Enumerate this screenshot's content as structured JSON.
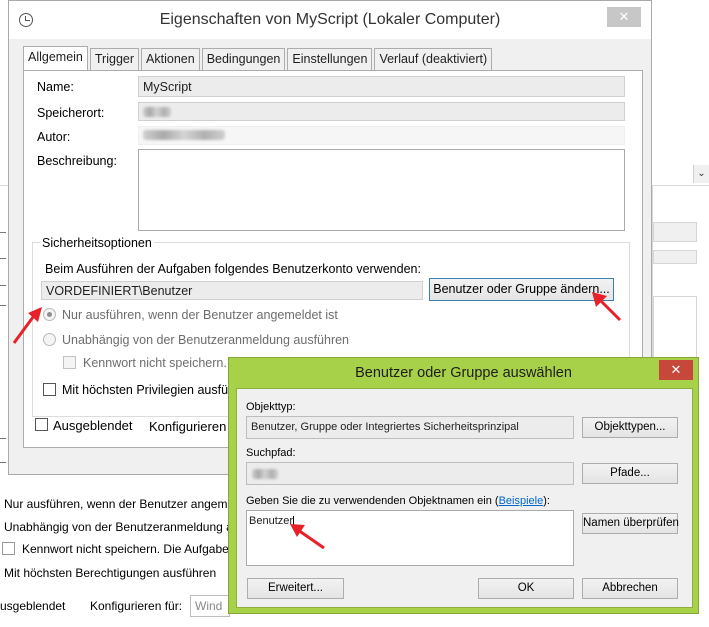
{
  "main_window": {
    "title": "Eigenschaften von MyScript (Lokaler Computer)",
    "close_glyph": "✕",
    "tabs": [
      "Allgemein",
      "Trigger",
      "Aktionen",
      "Bedingungen",
      "Einstellungen",
      "Verlauf (deaktiviert)"
    ],
    "active_tab": "Allgemein",
    "general": {
      "name_label": "Name:",
      "name_value": "MyScript",
      "location_label": "Speicherort:",
      "author_label": "Autor:",
      "description_label": "Beschreibung:"
    },
    "security": {
      "group_title": "Sicherheitsoptionen",
      "account_prompt": "Beim Ausführen der Aufgaben folgendes Benutzerkonto verwenden:",
      "account_value": "VORDEFINIERT\\Benutzer",
      "change_user_button": "Benutzer oder Gruppe ändern...",
      "radio_logged_on": "Nur ausführen, wenn der Benutzer angemeldet ist",
      "radio_independent": "Unabhängig von der Benutzeranmeldung ausführen",
      "no_store_password": "Kennwort nicht speichern.",
      "highest_privileges": "Mit höchsten Privilegien ausfü"
    },
    "hidden_label": "Ausgeblendet",
    "configure_label": "Konfigurieren f"
  },
  "background_window": {
    "scroll_glyph": "⌄",
    "lines": [
      "Nur ausführen, wenn der Benutzer angeme",
      "Unabhängig von der Benutzeranmeldung a",
      "Kennwort nicht speichern. Die Aufgabe",
      "Mit höchsten Berechtigungen ausführen",
      "usgeblendet",
      "Konfigurieren für:",
      "Wind"
    ]
  },
  "dialog": {
    "title": "Benutzer oder Gruppe auswählen",
    "close_glyph": "✕",
    "object_type_label": "Objekttyp:",
    "object_type_value": "Benutzer, Gruppe oder Integriertes Sicherheitsprinzipal",
    "object_types_button": "Objekttypen...",
    "path_label": "Suchpfad:",
    "paths_button": "Pfade...",
    "names_prompt": "Geben Sie die zu verwendenden Objektnamen ein (",
    "names_prompt_link": "Beispiele",
    "names_prompt_end": "):",
    "names_value": "Benutzer",
    "check_names_button": "Namen überprüfen",
    "advanced_button": "Erweitert...",
    "ok_button": "OK",
    "cancel_button": "Abbrechen"
  },
  "colors": {
    "dialog_frame": "#a8d14a",
    "dialog_close": "#c7473a",
    "annotation_arrow": "#e8202a",
    "link": "#0066cc"
  }
}
